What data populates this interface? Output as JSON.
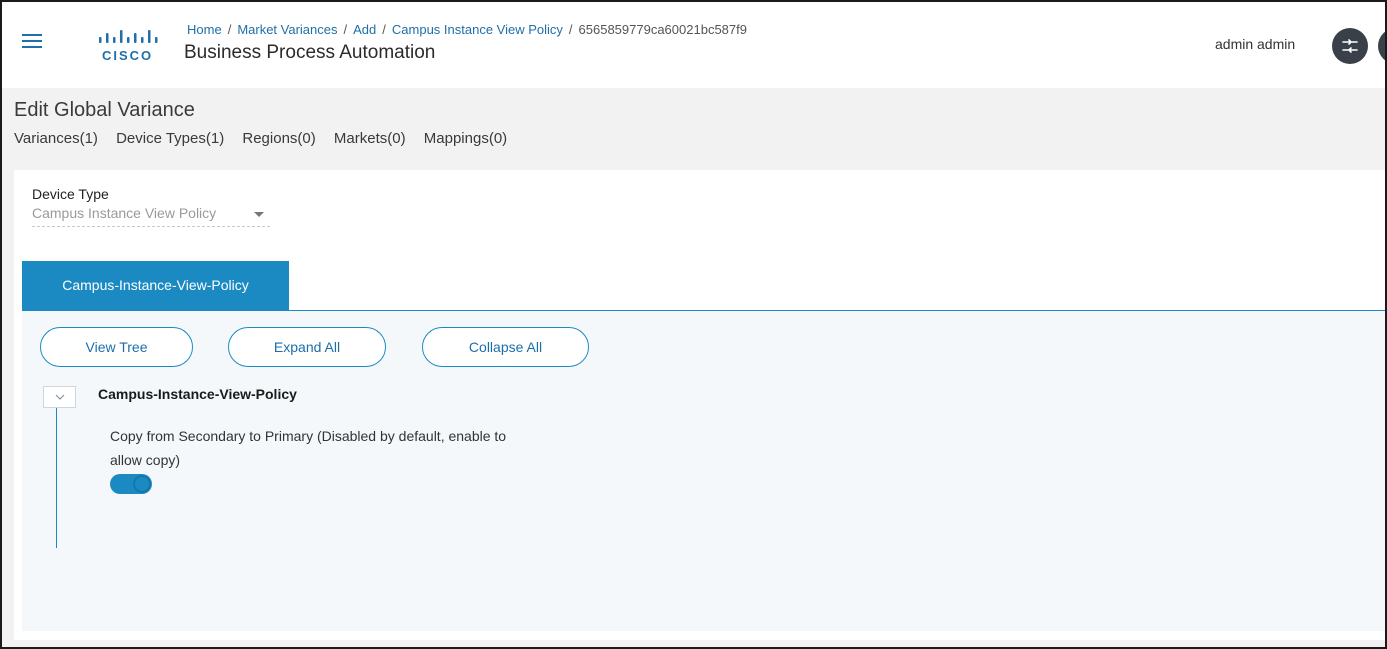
{
  "header": {
    "logo_text": "CISCO",
    "breadcrumb": [
      "Home",
      "Market Variances",
      "Add",
      "Campus Instance View Policy"
    ],
    "breadcrumb_current": "6565859779ca60021bc587f9",
    "app_title": "Business Process Automation",
    "user_name": "admin admin",
    "icons": [
      "hamburger-menu-icon",
      "cisco-logo",
      "network-apps-icon"
    ]
  },
  "page": {
    "title": "Edit Global Variance",
    "subtabs": [
      "Variances(1)",
      "Device Types(1)",
      "Regions(0)",
      "Markets(0)",
      "Mappings(0)"
    ]
  },
  "form": {
    "device_type_label": "Device Type",
    "device_type_value": "Campus Instance View Policy"
  },
  "tabs": {
    "active": "Campus-Instance-View-Policy"
  },
  "toolbar": {
    "view_tree": "View Tree",
    "expand_all": "Expand All",
    "collapse_all": "Collapse All"
  },
  "tree": {
    "node_title": "Campus-Instance-View-Policy",
    "property_label": "Copy from Secondary to Primary (Disabled by default, enable to allow copy)",
    "toggle_on": true
  },
  "colors": {
    "accent": "#1b8ac2",
    "brand": "#1f6fa8",
    "page_bg": "#f2f2f2",
    "panel_bg": "#f4f8fb"
  }
}
